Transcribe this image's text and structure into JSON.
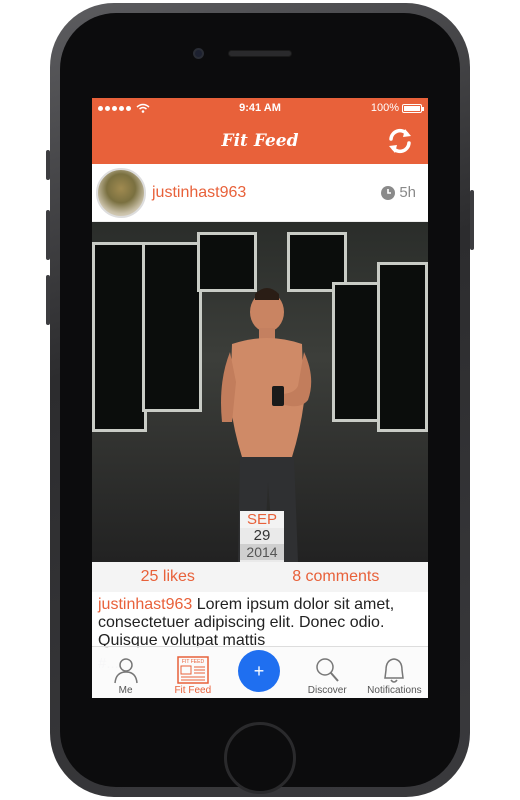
{
  "statusbar": {
    "time": "9:41 AM",
    "battery": "100%",
    "battery_level": 1.0
  },
  "navbar": {
    "title": "Fit Feed"
  },
  "post": {
    "username": "justinhast963",
    "time_ago": "5h",
    "date_badge": {
      "month": "SEP",
      "day": "29",
      "year": "2014"
    },
    "likes": "25 likes",
    "comments": "8 comments",
    "caption_user": "justinhast963",
    "caption_text": " Lorem ipsum dolor sit amet, consectetuer adipiscing elit. Donec odio. Quisque volutpat mattis",
    "hashtags": "#..."
  },
  "tabbar": {
    "items": [
      {
        "label": "Me",
        "icon": "person-icon"
      },
      {
        "label": "Fit Feed",
        "icon": "news-icon"
      },
      {
        "label": "",
        "icon": "plus-icon"
      },
      {
        "label": "Discover",
        "icon": "magnifier-icon"
      },
      {
        "label": "Notifications",
        "icon": "bell-icon"
      }
    ],
    "fab_label": "+",
    "feed_icon_label": "FIT FEED"
  },
  "colors": {
    "accent": "#e8613a",
    "fab": "#1f6ff0"
  }
}
